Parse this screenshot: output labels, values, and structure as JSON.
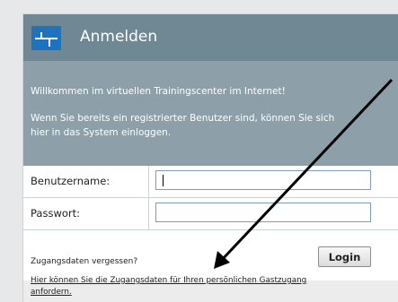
{
  "header": {
    "title": "Anmelden",
    "background": "#6f8894",
    "logo_color": "#1e73be",
    "logo_icon": "network-lines-icon"
  },
  "welcome": {
    "line1": "Willkommen im virtuellen Trainingscenter im Internet!",
    "line2": "Wenn Sie bereits ein registrierter Benutzer sind, können Sie sich",
    "line3": "hier in das System einloggen.",
    "background": "#8d9fa8"
  },
  "form": {
    "username_label": "Benutzername:",
    "username_value": "",
    "password_label": "Passwort:",
    "password_value": "",
    "forgot_text": "Zugangsdaten vergessen?",
    "login_label": "Login"
  },
  "guest_link": {
    "line1": "Hier können Sie die Zugangsdaten für Ihren persönlichen Gastzugang",
    "line2": "anfordern."
  },
  "annotation": {
    "arrow_color": "#000000"
  }
}
